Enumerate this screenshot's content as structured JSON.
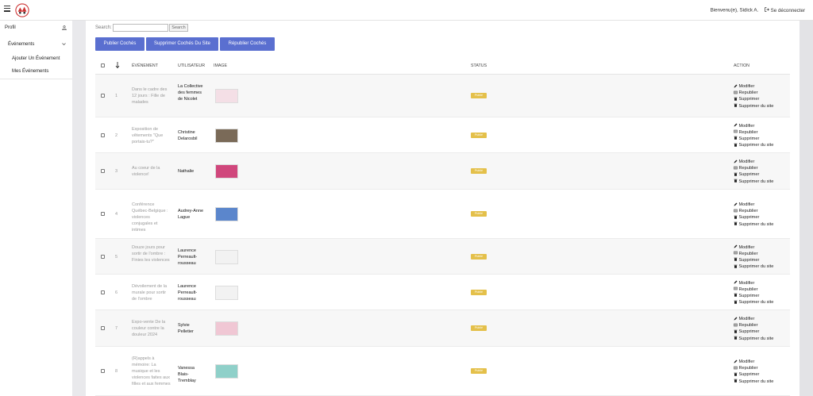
{
  "header": {
    "user_greeting": "Bienvenu(e), Sidick A.",
    "logout_label": "Se déconnecter"
  },
  "sidebar": {
    "profile_label": "Profil",
    "events_label": "Événements",
    "add_event_label": "Ajouter Un Événement",
    "my_events_label": "Mes Événements"
  },
  "search": {
    "label": "Search:",
    "value": "",
    "placeholder": "",
    "button_label": "Search"
  },
  "actions_bar": {
    "publish_label": "Publier Cochés",
    "delete_from_site_label": "Supprimer Cochés Du Site",
    "republish_label": "Républier Cochés"
  },
  "table": {
    "columns": {
      "event": "Événement",
      "user": "Utilisateur",
      "image": "Image",
      "status": "Status",
      "action": "Action"
    },
    "action_labels": {
      "edit": "Modifier",
      "republish": "Republier",
      "delete": "Supprimer",
      "delete_site": "Supprimer du site"
    },
    "rows": [
      {
        "num": "1",
        "event": "Dans le cadre des 12 jours : Fille de malades",
        "user": "La Collective des femmes de Nicolet",
        "status": "Publié",
        "image_color": "#f4dfe6"
      },
      {
        "num": "2",
        "event": "Exposition de vêtements \"Que portais-tu?\"",
        "user": "Christine Delarosbil",
        "status": "Publié",
        "image_color": "#7a6a58"
      },
      {
        "num": "3",
        "event": "Au coeur de la violence!",
        "user": "Nathalie",
        "status": "Publié",
        "image_color": "#d0477c"
      },
      {
        "num": "4",
        "event": "Conférence Québec-Belgique : violences conjugales et intimes",
        "user": "Audrey-Anne Lague",
        "status": "Publié",
        "image_color": "#5b86cc"
      },
      {
        "num": "5",
        "event": "Douze jours pour sortir de l'ombre : Finies les violences",
        "user": "Laurence Perreault-rousseau",
        "status": "Publié",
        "image_color": "#f2f2f2"
      },
      {
        "num": "6",
        "event": "Dévoilement de la murale pour sortir de l'ombre",
        "user": "Laurence Perreault-rousseau",
        "status": "Publié",
        "image_color": "#f2f2f2"
      },
      {
        "num": "7",
        "event": "Expo-vente De la couleur contre la douleur 2024",
        "user": "Sylvie Pelletier",
        "status": "Publié",
        "image_color": "#f0c7d4"
      },
      {
        "num": "8",
        "event": "(R)appels à mémoire: La musique et les violences faites aux filles et aux femmes",
        "user": "Vanessa Blais-Tremblay",
        "status": "Publié",
        "image_color": "#8fd0c9"
      }
    ]
  }
}
